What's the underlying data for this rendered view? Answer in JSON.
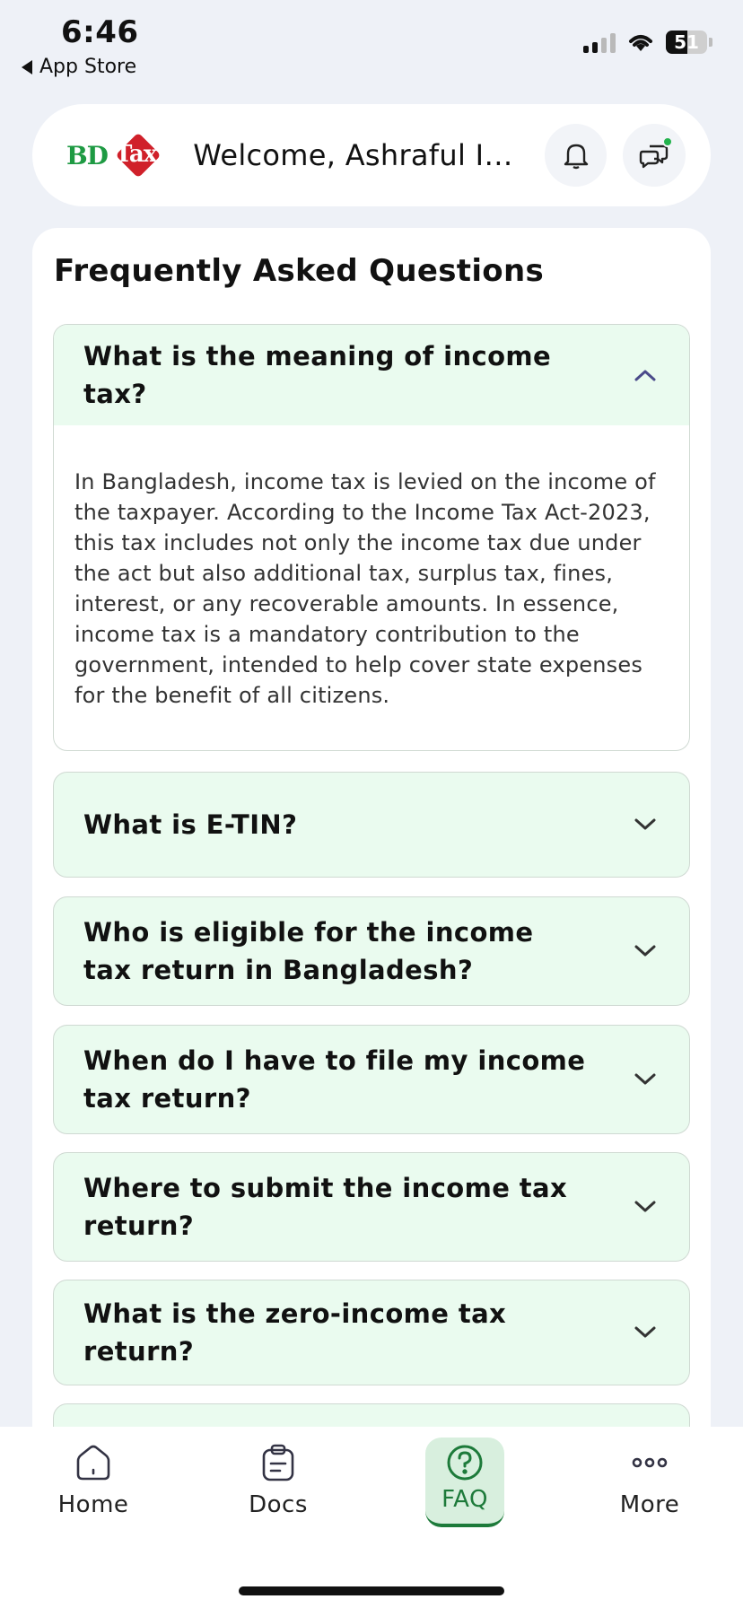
{
  "status_bar": {
    "time": "6:46",
    "back_label": "App Store",
    "battery": "51"
  },
  "header": {
    "logo_bd": "BD",
    "logo_tax": "Tax",
    "welcome": "Welcome, Ashraful Isl..."
  },
  "faq": {
    "title": "Frequently Asked Questions",
    "items": [
      {
        "question": "What is the meaning of income tax?",
        "answer": "In Bangladesh, income tax is levied on the income of the taxpayer. According to the Income Tax Act-2023, this tax includes not only the income tax due under the act but also additional tax, surplus tax, fines, interest, or any recoverable amounts. In essence, income tax is a mandatory contribution to the government, intended to help cover state expenses for the benefit of all citizens.",
        "expanded": true
      },
      {
        "question": "What is E-TIN?",
        "expanded": false
      },
      {
        "question": "Who is eligible for the income tax return in Bangladesh?",
        "expanded": false
      },
      {
        "question": "When do I have to file my income tax return?",
        "expanded": false
      },
      {
        "question": "Where to submit the income tax return?",
        "expanded": false
      },
      {
        "question": "What is the zero-income tax return?",
        "expanded": false
      }
    ]
  },
  "bottom_nav": {
    "items": [
      {
        "label": "Home",
        "icon": "home-icon"
      },
      {
        "label": "Docs",
        "icon": "docs-icon"
      },
      {
        "label": "FAQ",
        "icon": "help-circle-icon",
        "active": true
      },
      {
        "label": "More",
        "icon": "more-dots-icon"
      }
    ]
  },
  "colors": {
    "accent_green": "#1d7a3a",
    "faq_bg": "#eafbef",
    "logo_red": "#d0202a"
  }
}
